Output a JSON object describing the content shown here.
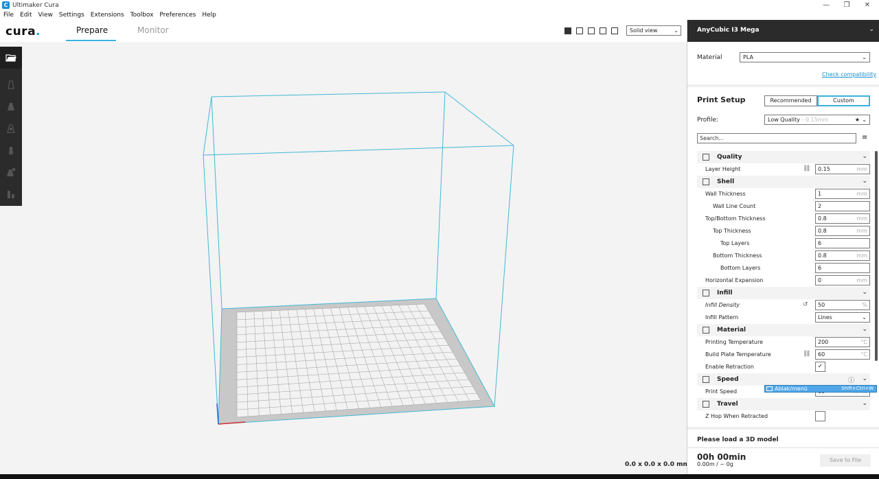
{
  "window": {
    "title": "Ultimaker Cura",
    "logo_letter": "C",
    "minimize_glyph": "—",
    "maximize_glyph": "❐",
    "close_glyph": "✕"
  },
  "menu": [
    "File",
    "Edit",
    "View",
    "Settings",
    "Extensions",
    "Toolbox",
    "Preferences",
    "Help"
  ],
  "header": {
    "logo_text": "cura",
    "logo_dot": ".",
    "tabs": [
      {
        "label": "Prepare",
        "active": true
      },
      {
        "label": "Monitor",
        "active": false
      }
    ],
    "view_mode": "Solid view",
    "view_icons": [
      "3d-view-icon",
      "front-view-icon",
      "top-view-icon",
      "left-view-icon",
      "right-view-icon"
    ]
  },
  "tools": [
    "open-file-icon",
    "move-icon",
    "scale-icon",
    "rotate-icon",
    "mirror-icon",
    "per-model-settings-icon",
    "support-blocker-icon"
  ],
  "viewport": {
    "dimensions": "0.0 x 0.0 x 0.0 mm"
  },
  "sidebar": {
    "printer_name": "AnyCubic I3 Mega",
    "material_label": "Material",
    "material_value": "PLA",
    "check_compatibility": "Check compatibility",
    "print_setup_title": "Print Setup",
    "mode_buttons": [
      "Recommended",
      "Custom"
    ],
    "profile_label": "Profile:",
    "profile_value": "Low Quality",
    "profile_suffix": " - 0.15mm",
    "search_placeholder": "Search...",
    "settings": [
      {
        "type": "category",
        "label": "Quality",
        "icon": "quality-icon"
      },
      {
        "type": "setting",
        "label": "Layer Height",
        "value": "0.15",
        "unit": "mm",
        "indent": 0,
        "linked": true
      },
      {
        "type": "category",
        "label": "Shell",
        "icon": "shell-icon"
      },
      {
        "type": "setting",
        "label": "Wall Thickness",
        "value": "1",
        "unit": "mm",
        "indent": 0
      },
      {
        "type": "setting",
        "label": "Wall Line Count",
        "value": "2",
        "unit": "",
        "indent": 1
      },
      {
        "type": "setting",
        "label": "Top/Bottom Thickness",
        "value": "0.8",
        "unit": "mm",
        "indent": 0
      },
      {
        "type": "setting",
        "label": "Top Thickness",
        "value": "0.8",
        "unit": "mm",
        "indent": 1
      },
      {
        "type": "setting",
        "label": "Top Layers",
        "value": "6",
        "unit": "",
        "indent": 2
      },
      {
        "type": "setting",
        "label": "Bottom Thickness",
        "value": "0.8",
        "unit": "mm",
        "indent": 1
      },
      {
        "type": "setting",
        "label": "Bottom Layers",
        "value": "6",
        "unit": "",
        "indent": 2
      },
      {
        "type": "setting",
        "label": "Horizontal Expansion",
        "value": "0",
        "unit": "mm",
        "indent": 0
      },
      {
        "type": "category",
        "label": "Infill",
        "icon": "infill-icon"
      },
      {
        "type": "setting",
        "label": "Infill Density",
        "value": "50",
        "unit": "%",
        "indent": 0,
        "italic": true,
        "reset": true
      },
      {
        "type": "select",
        "label": "Infill Pattern",
        "value": "Lines",
        "indent": 0
      },
      {
        "type": "category",
        "label": "Material",
        "icon": "material-icon"
      },
      {
        "type": "setting",
        "label": "Printing Temperature",
        "value": "200",
        "unit": "°C",
        "indent": 0
      },
      {
        "type": "setting",
        "label": "Build Plate Temperature",
        "value": "60",
        "unit": "°C",
        "indent": 0,
        "linked": true
      },
      {
        "type": "checkbox",
        "label": "Enable Retraction",
        "checked": true,
        "indent": 0
      },
      {
        "type": "category",
        "label": "Speed",
        "icon": "speed-icon",
        "info": true
      },
      {
        "type": "setting",
        "label": "Print Speed",
        "value": "60",
        "unit": "mm/s",
        "indent": 0
      },
      {
        "type": "category",
        "label": "Travel",
        "icon": "travel-icon"
      },
      {
        "type": "checkbox",
        "label": "Z Hop When Retracted",
        "checked": false,
        "indent": 0
      }
    ],
    "tooltip": {
      "label": "Ablak/menü",
      "shortcut": "Shift+Ctrl+W"
    },
    "load_message": "Please load a 3D model",
    "time_estimate": "00h 00min",
    "usage_estimate": "0.00m / ~ 0g",
    "save_button": "Save to File"
  },
  "colors": {
    "accent": "#38b1e0",
    "build_volume": "#3fb8d6",
    "dark_panel": "#2b2b2b"
  }
}
